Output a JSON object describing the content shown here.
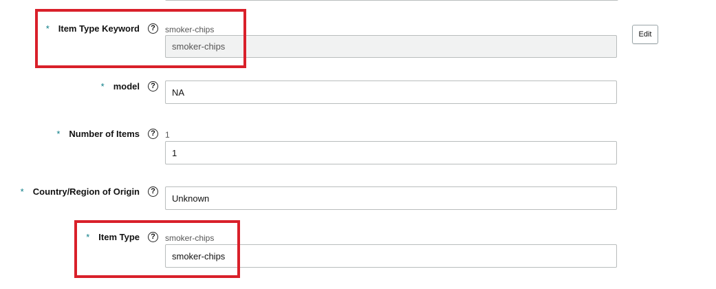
{
  "form": {
    "item_type_keyword": {
      "required_mark": "*",
      "label": "Item Type Keyword",
      "hint": "smoker-chips",
      "value": "smoker-chips"
    },
    "edit_button_label": "Edit",
    "model": {
      "required_mark": "*",
      "label": "model",
      "value": "NA"
    },
    "number_of_items": {
      "required_mark": "*",
      "label": "Number of Items",
      "hint": "1",
      "value": "1"
    },
    "country_of_origin": {
      "required_mark": "*",
      "label": "Country/Region of Origin",
      "value": "Unknown"
    },
    "item_type": {
      "required_mark": "*",
      "label": "Item Type",
      "hint": "smoker-chips",
      "value": "smoker-chips"
    },
    "help_glyph": "?"
  },
  "colors": {
    "highlight": "#d9202a",
    "asterisk": "#0a7c86"
  }
}
